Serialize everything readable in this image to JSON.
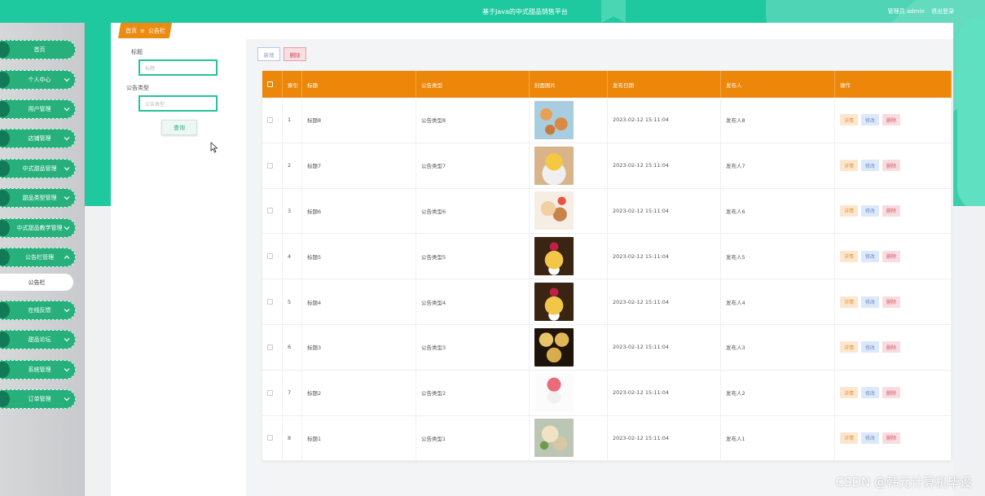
{
  "header": {
    "site_title": "基于Java的中式甜品销售平台",
    "user_label": "管理员 admin",
    "logout_label": "退出登录"
  },
  "breadcrumb": {
    "home": "首页",
    "sep": "≡",
    "current": "公告栏"
  },
  "sidebar": {
    "items": [
      {
        "label": "首页",
        "has_chevron": false
      },
      {
        "label": "个人中心",
        "has_chevron": true
      },
      {
        "label": "用户管理",
        "has_chevron": true
      },
      {
        "label": "店铺管理",
        "has_chevron": true
      },
      {
        "label": "中式甜品管理",
        "has_chevron": true
      },
      {
        "label": "甜品类型管理",
        "has_chevron": true
      },
      {
        "label": "中式甜品教学管理",
        "has_chevron": true
      },
      {
        "label": "公告栏管理",
        "has_chevron": true,
        "expanded": true
      },
      {
        "label": "在线反馈",
        "has_chevron": true
      },
      {
        "label": "甜品论坛",
        "has_chevron": true
      },
      {
        "label": "系统管理",
        "has_chevron": true
      },
      {
        "label": "订单管理",
        "has_chevron": true
      }
    ],
    "submenu_label": "公告栏"
  },
  "search": {
    "title_label": "标题",
    "title_placeholder": "标题",
    "type_label": "公告类型",
    "type_placeholder": "公告类型",
    "query_button": "查询"
  },
  "toolbar": {
    "add_label": "新增",
    "delete_label": "删除"
  },
  "table": {
    "headers": [
      "",
      "索引",
      "标题",
      "公告类型",
      "封面图片",
      "发布日期",
      "发布人",
      "操作"
    ],
    "rows": [
      {
        "index": "1",
        "title": "标题8",
        "type": "公告类型8",
        "date": "2023-02-12 15:11:04",
        "publisher": "发布人8"
      },
      {
        "index": "2",
        "title": "标题7",
        "type": "公告类型7",
        "date": "2023-02-12 15:11:04",
        "publisher": "发布人7"
      },
      {
        "index": "3",
        "title": "标题6",
        "type": "公告类型6",
        "date": "2023-02-12 15:11:04",
        "publisher": "发布人6"
      },
      {
        "index": "4",
        "title": "标题5",
        "type": "公告类型5",
        "date": "2023-02-12 15:11:04",
        "publisher": "发布人5"
      },
      {
        "index": "5",
        "title": "标题4",
        "type": "公告类型4",
        "date": "2023-02-12 15:11:04",
        "publisher": "发布人4"
      },
      {
        "index": "6",
        "title": "标题3",
        "type": "公告类型3",
        "date": "2023-02-12 15:11:04",
        "publisher": "发布人3"
      },
      {
        "index": "7",
        "title": "标题2",
        "type": "公告类型2",
        "date": "2023-02-12 15:11:04",
        "publisher": "发布人2"
      },
      {
        "index": "8",
        "title": "标题1",
        "type": "公告类型1",
        "date": "2023-02-12 15:11:04",
        "publisher": "发布人1"
      }
    ],
    "op_detail": "详情",
    "op_edit": "修改",
    "op_delete": "删除"
  },
  "watermark": "CSDN @韩元计算机毕设",
  "colors": {
    "brand_green": "#1ec9a0",
    "sidebar_item": "#27b07c",
    "table_header": "#ec8709",
    "breadcrumb": "#ec8b12"
  }
}
